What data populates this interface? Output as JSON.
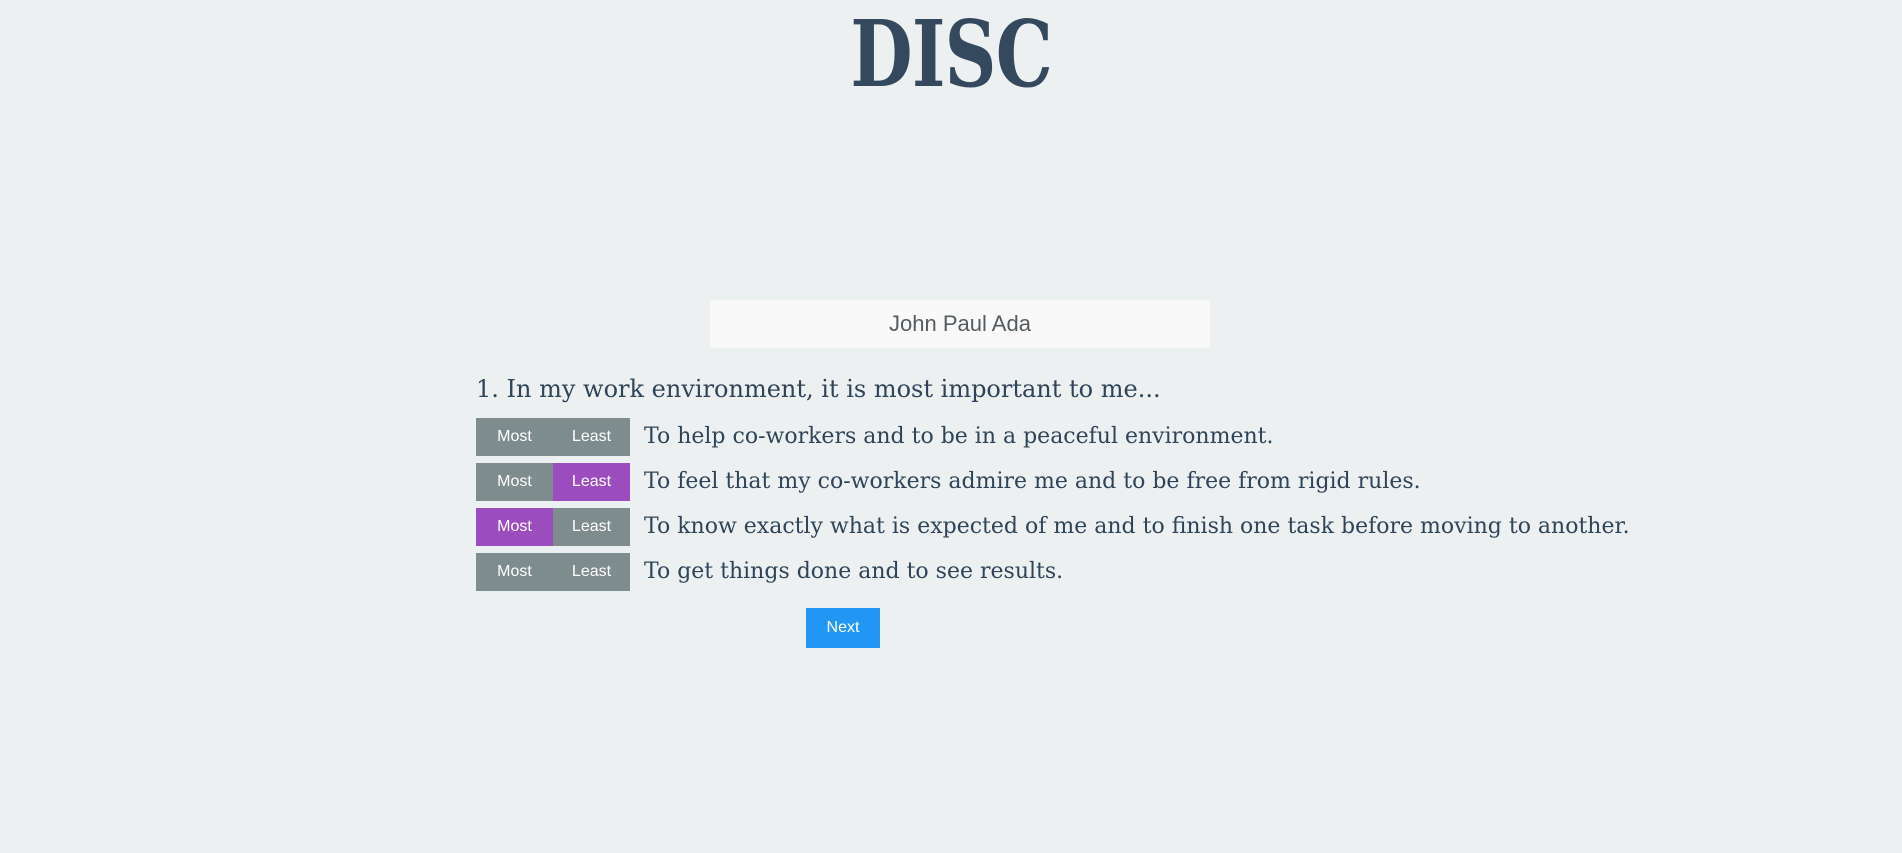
{
  "app": {
    "title": "DISC",
    "background_color": "#ecf0f1",
    "title_color": "#34495e"
  },
  "colors": {
    "toggle_unselected": "#7f8c8d",
    "toggle_selected": "#9b4dbe",
    "next_button": "#2196f3",
    "input_background": "#f9f9f9",
    "text": "#2f4458"
  },
  "name_field": {
    "value": "John Paul Ada",
    "placeholder": "Name"
  },
  "question": {
    "number": "1.",
    "text": "1. In my work environment, it is most important to me...",
    "options": [
      {
        "text": "To help co-workers and to be in a peaceful environment.",
        "most_label": "Most",
        "least_label": "Least",
        "selection": "none"
      },
      {
        "text": "To feel that my co-workers admire me and to be free from rigid rules.",
        "most_label": "Most",
        "least_label": "Least",
        "selection": "least"
      },
      {
        "text": "To know exactly what is expected of me and to finish one task before moving to another.",
        "most_label": "Most",
        "least_label": "Least",
        "selection": "most"
      },
      {
        "text": "To get things done and to see results.",
        "most_label": "Most",
        "least_label": "Least",
        "selection": "none"
      }
    ]
  },
  "next_button": {
    "label": "Next"
  }
}
